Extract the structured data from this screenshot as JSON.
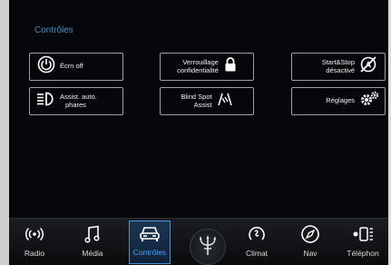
{
  "screen": {
    "title": "Contrôles"
  },
  "controls": [
    {
      "id": "ecran-off",
      "label": "Écrn off"
    },
    {
      "id": "verrouillage",
      "label_line1": "Verrouillage",
      "label_line2": "confidentialité"
    },
    {
      "id": "start-stop",
      "label_line1": "Start&Stop",
      "label_line2": "désactivé"
    },
    {
      "id": "assist-phares",
      "label_line1": "Assist. auto.",
      "label_line2": "phares"
    },
    {
      "id": "blind-spot",
      "label_line1": "Blind Spot",
      "label_line2": "Assist"
    },
    {
      "id": "reglages",
      "label": "Réglages"
    }
  ],
  "nav": {
    "items": [
      {
        "label": "Radio",
        "icon": "radio-icon"
      },
      {
        "label": "Média",
        "icon": "music-note-icon"
      },
      {
        "label": "Contrôles",
        "icon": "car-icon",
        "active": true
      },
      {
        "label": "",
        "icon": "trident-logo-icon"
      },
      {
        "label": "Climat",
        "icon": "climate-icon"
      },
      {
        "label": "Nav",
        "icon": "compass-icon"
      },
      {
        "label": "Téléphon",
        "icon": "phone-icon"
      }
    ]
  },
  "colors": {
    "accent": "#4a90d9",
    "title": "#4e8cc8",
    "background": "#05070b"
  }
}
